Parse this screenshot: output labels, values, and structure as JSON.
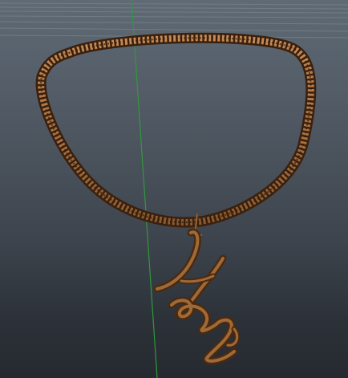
{
  "viewport": {
    "background_top": "#5f6a74",
    "background_bottom": "#262a30",
    "grid_color": "#7c8791",
    "axis_color": "#2f9a3b"
  },
  "model": {
    "chain_color_light": "#c08552",
    "chain_color_dark": "#3a200d",
    "pendant_text": "Hers",
    "pendant_color": "#7a4b23"
  }
}
